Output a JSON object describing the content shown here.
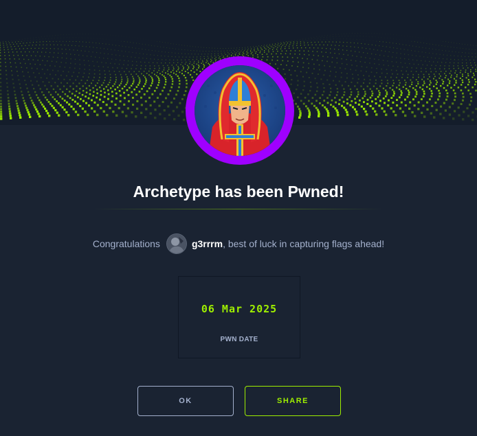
{
  "banner": {
    "accent_color": "#9fef00",
    "background": "#141d2b"
  },
  "machine": {
    "avatar_ring_color": "#9f00ff",
    "title": "Archetype has been Pwned!"
  },
  "congrats": {
    "prefix": "Congratulations",
    "username": "g3rrrm",
    "suffix": ", best of luck in capturing flags ahead!"
  },
  "pwn": {
    "date": "06 Mar 2025",
    "label": "PWN DATE"
  },
  "actions": {
    "ok_label": "OK",
    "share_label": "SHARE"
  }
}
